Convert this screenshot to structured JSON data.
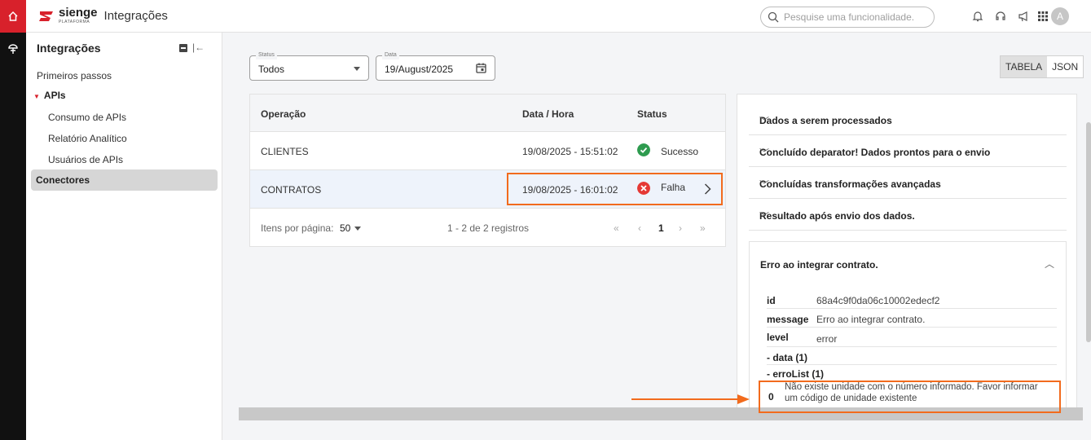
{
  "app": {
    "brand": "sienge",
    "brand_sub": "PLATAFORMA",
    "title": "Integrações",
    "search_placeholder": "Pesquise uma funcionalidade.",
    "avatar_initial": "A"
  },
  "sidebar": {
    "title": "Integrações",
    "items": {
      "primeiros_passos": "Primeiros passos",
      "apis": "APIs",
      "consumo": "Consumo de APIs",
      "relatorio": "Relatório Analítico",
      "usuarios": "Usuários de APIs",
      "conectores": "Conectores"
    }
  },
  "filters": {
    "status_label": "Status",
    "status_value": "Todos",
    "date_label": "Data",
    "date_value": "19/August/2025"
  },
  "view_tabs": {
    "table": "TABELA",
    "json": "JSON"
  },
  "table": {
    "headers": {
      "op": "Operação",
      "date": "Data / Hora",
      "status": "Status"
    },
    "rows": [
      {
        "op": "CLIENTES",
        "date": "19/08/2025 - 15:51:02",
        "status": "Sucesso"
      },
      {
        "op": "CONTRATOS",
        "date": "19/08/2025 - 16:01:02",
        "status": "Falha"
      }
    ],
    "pager": {
      "per_page_label": "Itens por página:",
      "per_page_value": "50",
      "range": "1 - 2 de 2 registros",
      "page": "1"
    }
  },
  "details": {
    "sections": [
      "Dados a serem processados",
      "Concluído deparator! Dados prontos para o envio",
      "Concluídas transformações avançadas",
      "Resultado após envio dos dados."
    ],
    "error": {
      "title": "Erro ao integrar contrato.",
      "id_key": "id",
      "id_val": "68a4c9f0da06c10002edecf2",
      "message_key": "message",
      "message_val": "Erro ao integrar contrato.",
      "level_key": "level",
      "level_val": "error",
      "data_key": "- data (1)",
      "errolist_key": "- erroList (1)",
      "item_index": "0",
      "item_line1": "Não existe unidade com o número informado. Favor informar",
      "item_line2": "um código de unidade existente"
    }
  },
  "colors": {
    "brand_red": "#d8212b",
    "highlight": "#f26b1d",
    "success": "#2e9b4f",
    "error": "#e53935"
  }
}
